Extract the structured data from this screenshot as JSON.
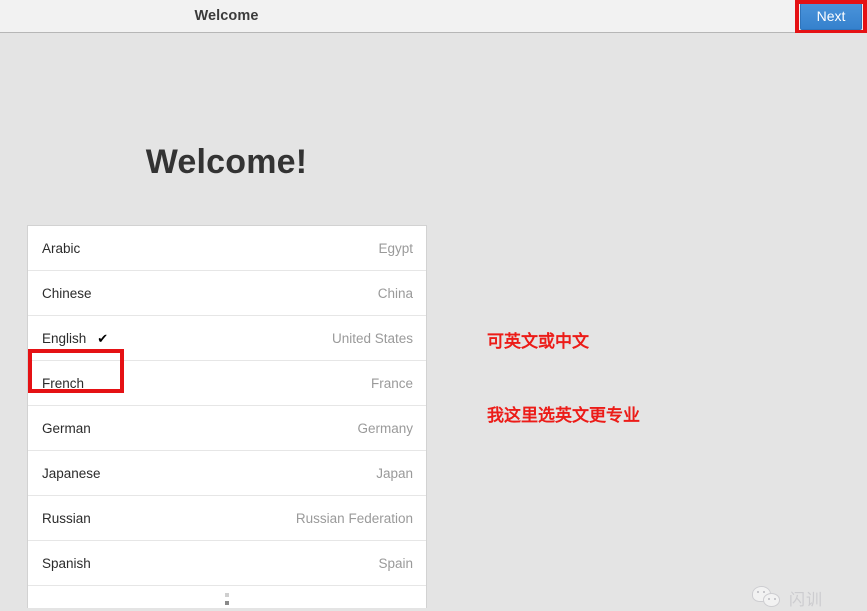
{
  "window": {
    "title": "Welcome"
  },
  "header": {
    "title": "Welcome",
    "next_label": "Next",
    "next_button_color": "#3b88d4"
  },
  "main": {
    "heading": "Welcome!",
    "selected_language": "English",
    "check_glyph": "✔",
    "languages": [
      {
        "name": "Arabic",
        "country": "Egypt",
        "selected": false
      },
      {
        "name": "Chinese",
        "country": "China",
        "selected": false
      },
      {
        "name": "English",
        "country": "United States",
        "selected": true
      },
      {
        "name": "French",
        "country": "France",
        "selected": false
      },
      {
        "name": "German",
        "country": "Germany",
        "selected": false
      },
      {
        "name": "Japanese",
        "country": "Japan",
        "selected": false
      },
      {
        "name": "Russian",
        "country": "Russian Federation",
        "selected": false
      },
      {
        "name": "Spanish",
        "country": "Spain",
        "selected": false
      }
    ],
    "more_indicator": "vertical-ellipsis"
  },
  "annotations": {
    "color": "#ec1c18",
    "note_line1": "可英文或中文",
    "note_line2": "我这里选英文更专业",
    "highlight_next_button": true,
    "highlight_english_row": true
  },
  "watermark": {
    "icon": "wechat-icon",
    "text": "闪训",
    "color": "#b9b9bf"
  }
}
